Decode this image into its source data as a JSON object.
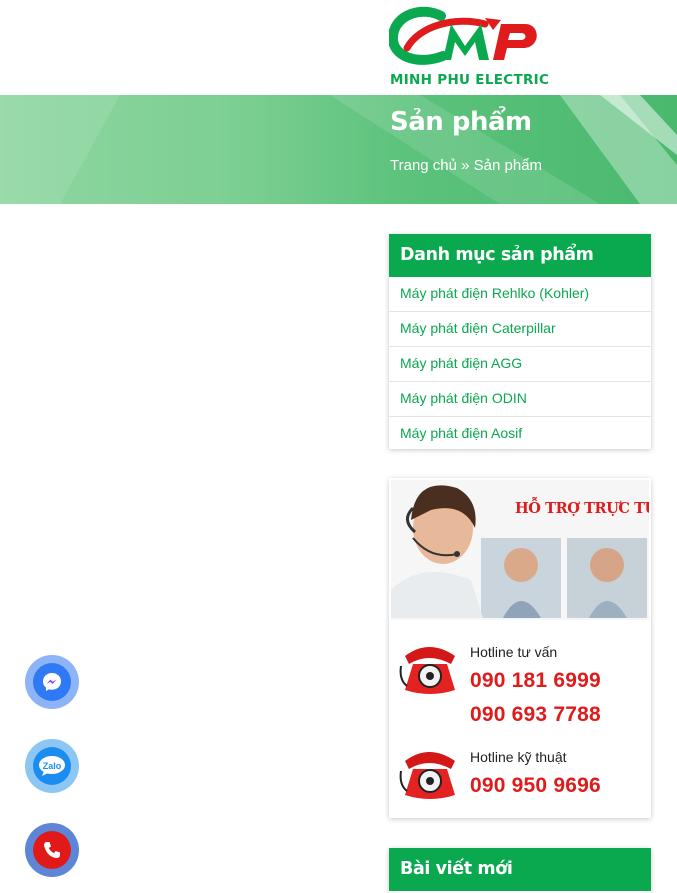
{
  "brand": {
    "logo_text": "MINH PHU ELECTRIC",
    "color_green": "#0aa84f",
    "color_red": "#e01b1b"
  },
  "banner": {
    "title": "Sản phẩm",
    "breadcrumb_home": "Trang chủ",
    "breadcrumb_sep": "»",
    "breadcrumb_current": "Sản phẩm"
  },
  "categories": {
    "title": "Danh mục sản phẩm",
    "items": [
      "Máy phát điện Rehlko (Kohler)",
      "Máy phát điện Caterpillar",
      "Máy phát điện AGG",
      "Máy phát điện ODIN",
      "Máy phát điện Aosif"
    ]
  },
  "support": {
    "tagline": "HỖ TRỢ TRỰC TUYẾN",
    "consult_label": "Hotline tư vấn",
    "consult_phone_1": "090 181 6999",
    "consult_phone_2": "090 693 7788",
    "tech_label": "Hotline kỹ thuật",
    "tech_phone": "090 950 9696"
  },
  "news": {
    "title": "Bài viết mới"
  },
  "floating": {
    "zalo_label": "Zalo",
    "icons": [
      "messenger-icon",
      "zalo-icon",
      "phone-icon"
    ]
  }
}
